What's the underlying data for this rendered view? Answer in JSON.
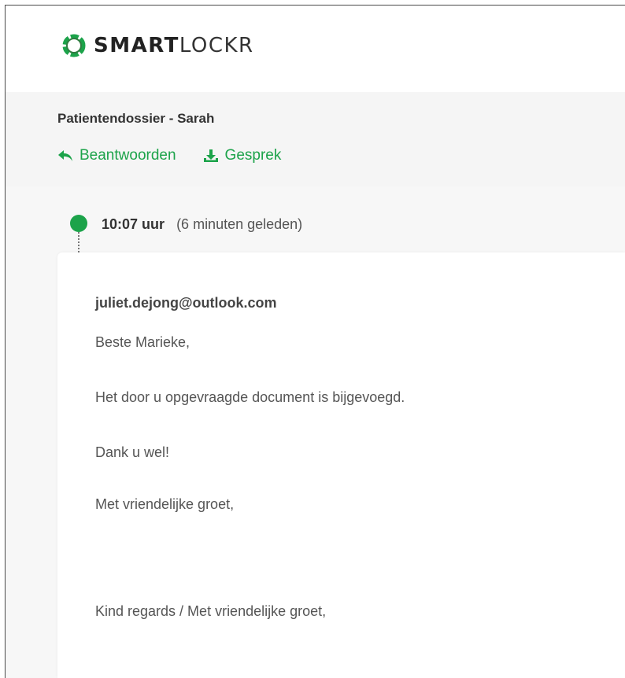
{
  "brand": {
    "name_bold": "SMART",
    "name_light": "LOCKR",
    "color": "#1ca34a"
  },
  "conversation": {
    "title": "Patientendossier - Sarah",
    "actions": {
      "reply_label": "Beantwoorden",
      "reply_icon": "reply-arrow-icon",
      "download_label": "Gesprek",
      "download_icon": "download-icon"
    }
  },
  "message": {
    "time": "10:07 uur",
    "relative_time": "(6 minuten geleden)",
    "sender": "juliet.dejong@outlook.com",
    "lines": [
      "Beste Marieke,",
      "Het door u opgevraagde document is bijgevoegd.",
      "Dank u wel!",
      "Met vriendelijke groet,",
      "Kind regards / Met vriendelijke groet,"
    ]
  }
}
